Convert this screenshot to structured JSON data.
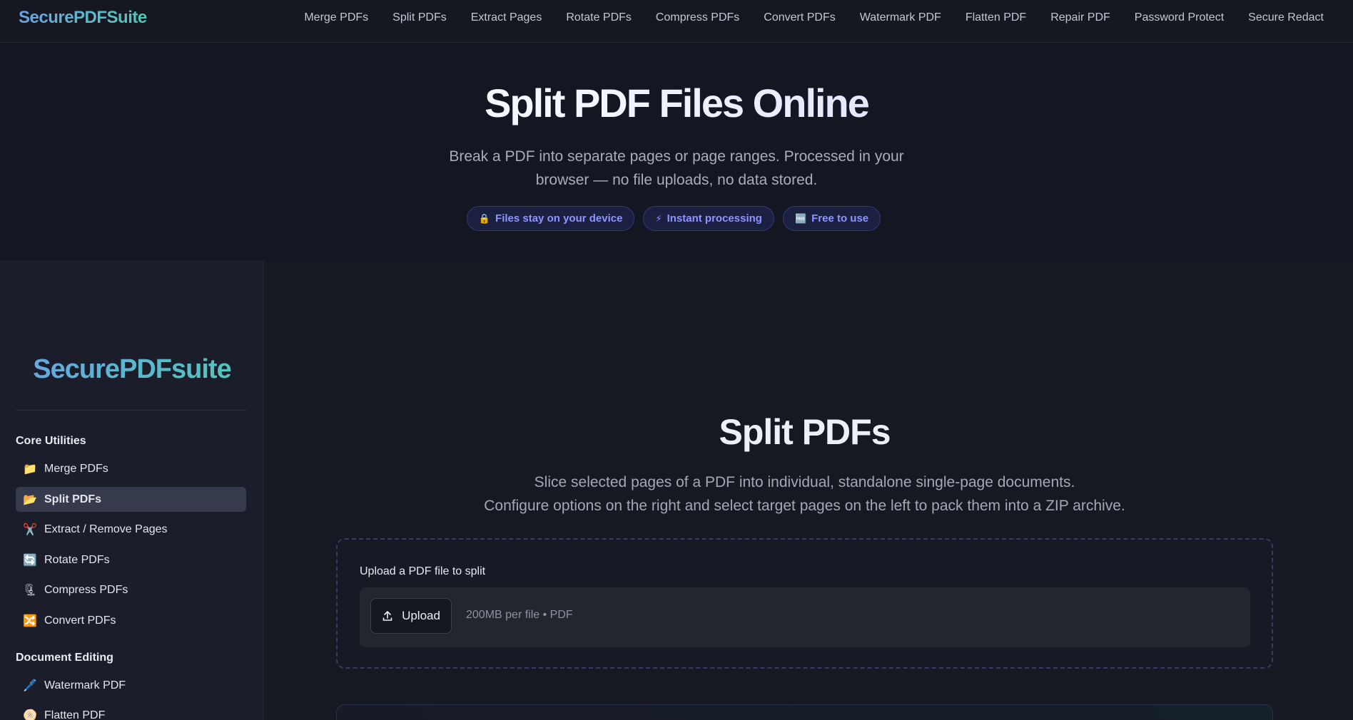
{
  "brand": "SecurePDFSuite",
  "nav": [
    "Merge PDFs",
    "Split PDFs",
    "Extract Pages",
    "Rotate PDFs",
    "Compress PDFs",
    "Convert PDFs",
    "Watermark PDF",
    "Flatten PDF",
    "Repair PDF",
    "Password Protect",
    "Secure Redact"
  ],
  "hero": {
    "title": "Split PDF Files Online",
    "subtitle": "Break a PDF into separate pages or page ranges. Processed in your browser — no file uploads, no data stored.",
    "badges": [
      {
        "icon": "lock-icon",
        "glyph": "🔒",
        "label": "Files stay on your device"
      },
      {
        "icon": "lightning-icon",
        "glyph": "⚡",
        "label": "Instant processing"
      },
      {
        "icon": "free-icon",
        "glyph": "🆓",
        "label": "Free to use"
      }
    ]
  },
  "sidebar": {
    "brand": "SecurePDFsuite",
    "sections": [
      {
        "title": "Core Utilities",
        "items": [
          {
            "label": "Merge PDFs",
            "icon": "folder-icon",
            "glyph": "📁"
          },
          {
            "label": "Split PDFs",
            "icon": "open-folder-icon",
            "glyph": "📂",
            "active": true
          },
          {
            "label": "Extract / Remove Pages",
            "icon": "scissors-icon",
            "glyph": "✂️"
          },
          {
            "label": "Rotate PDFs",
            "icon": "rotate-icon",
            "glyph": "🔄"
          },
          {
            "label": "Compress PDFs",
            "icon": "compress-icon",
            "glyph": "🗜"
          },
          {
            "label": "Convert PDFs",
            "icon": "shuffle-icon",
            "glyph": "🔀"
          }
        ]
      },
      {
        "title": "Document Editing",
        "items": [
          {
            "label": "Watermark PDF",
            "icon": "pen-icon",
            "glyph": "🖊️"
          },
          {
            "label": "Flatten PDF",
            "icon": "flatten-icon",
            "glyph": "🫓"
          }
        ]
      }
    ]
  },
  "main": {
    "title": "Split PDFs",
    "subtitle_line1": "Slice selected pages of a PDF into individual, standalone single-page documents.",
    "subtitle_line2": "Configure options on the right and select target pages on the left to pack them into a ZIP archive.",
    "upload": {
      "label": "Upload a PDF file to split",
      "button": "Upload",
      "hint": "200MB per file • PDF"
    }
  },
  "colors": {
    "background": "#14161f",
    "accent": "#8f94ff",
    "brand_start": "#6aa3e6",
    "brand_end": "#4fc9b6"
  }
}
